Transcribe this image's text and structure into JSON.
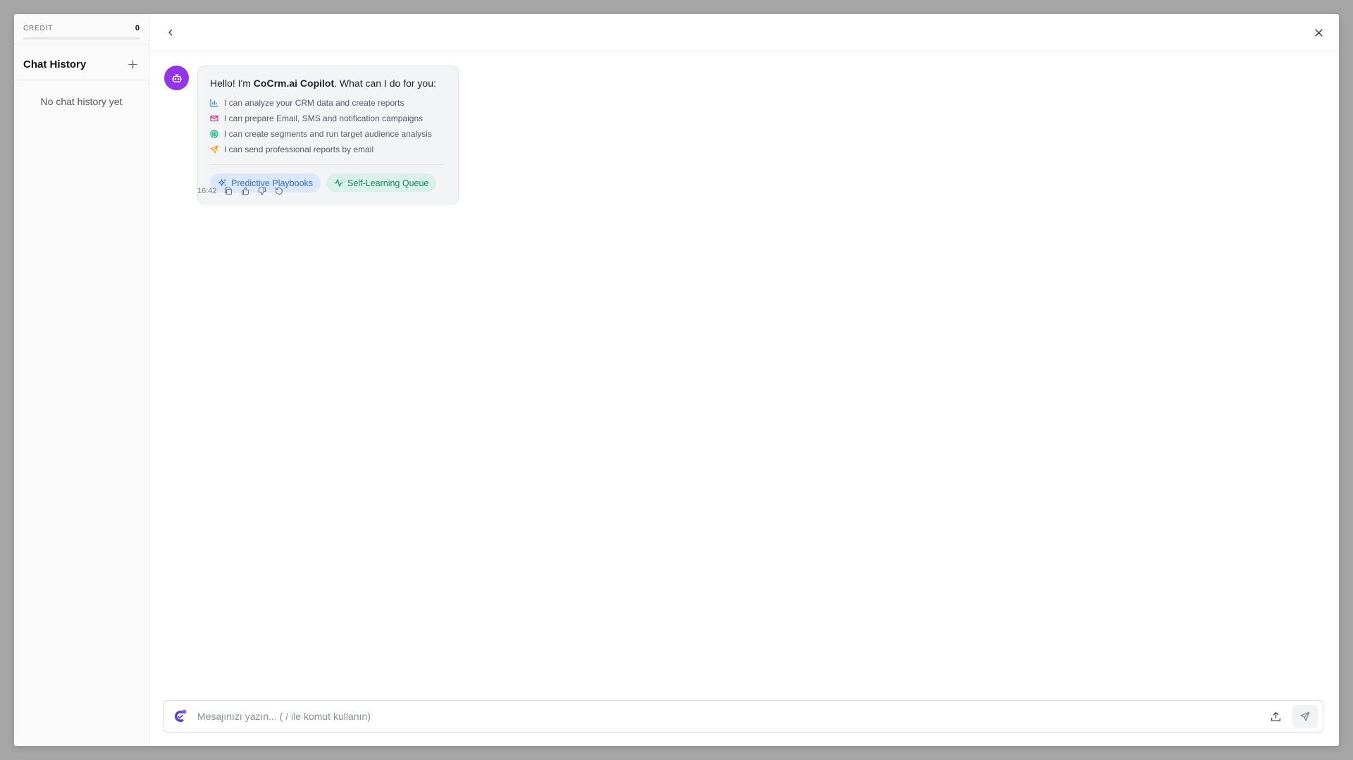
{
  "sidebar": {
    "credit_label": "CREDİT",
    "credit_value": "0",
    "credit_progress": 0,
    "history_title": "Chat History",
    "add_icon": "plus-icon",
    "empty_text": "No chat history yet"
  },
  "topbar": {
    "back_icon": "chevron-left-icon",
    "close_icon": "close-icon"
  },
  "message": {
    "avatar_icon": "bot-icon",
    "greeting_prefix": "Hello! I'm ",
    "greeting_brand": "CoCrm.ai Copilot",
    "greeting_suffix": ". What can I do for you:",
    "features": [
      {
        "icon": "bar-chart-icon",
        "color": "#3b82f6",
        "text": "I can analyze your CRM data and create reports"
      },
      {
        "icon": "mail-icon",
        "color": "#db2777",
        "text": "I can prepare Email, SMS and notification campaigns"
      },
      {
        "icon": "target-icon",
        "color": "#10b981",
        "text": "I can create segments and run target audience analysis"
      },
      {
        "icon": "send-icon",
        "color": "#f59e0b",
        "text": "I can send professional reports by email"
      }
    ],
    "chips": [
      {
        "icon": "sparkles-icon",
        "label": "Predictive Playbooks"
      },
      {
        "icon": "activity-icon",
        "label": "Self-Learning Queue"
      }
    ],
    "time": "16:42",
    "actions": [
      "copy-icon",
      "thumbs-up-icon",
      "thumbs-down-icon",
      "refresh-icon"
    ]
  },
  "composer": {
    "placeholder": "Mesajınızı yazın... ( / ile komut kullanın)",
    "value": "",
    "upload_icon": "upload-icon",
    "send_icon": "send-icon"
  },
  "colors": {
    "accent": "#9333ea",
    "chip_blue_bg": "#dbe8fb",
    "chip_blue_text": "#2f6fdd",
    "chip_green_bg": "#d9f1e7",
    "chip_green_text": "#138a5a"
  }
}
